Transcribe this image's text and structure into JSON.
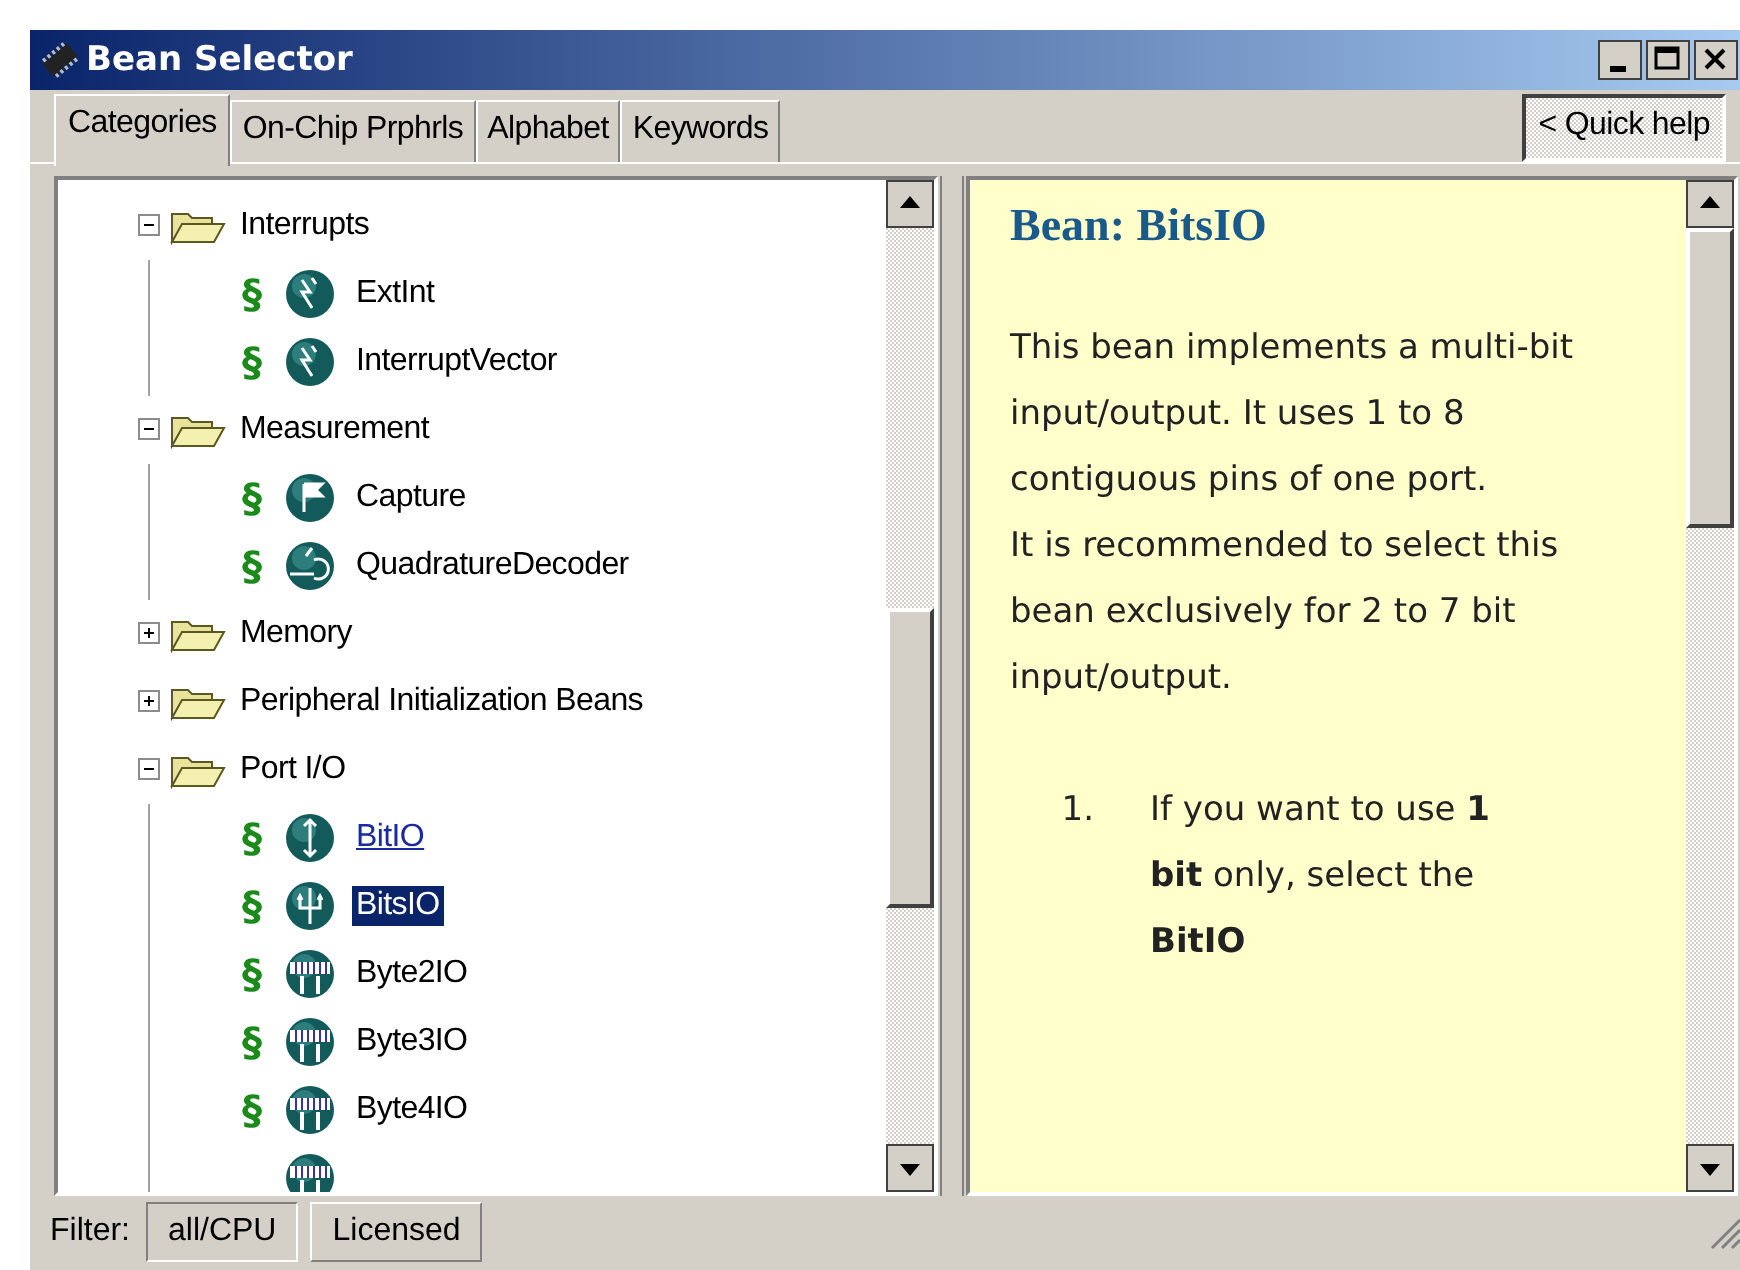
{
  "window": {
    "title": "Bean Selector"
  },
  "tabs": [
    {
      "label": "Categories",
      "selected": true
    },
    {
      "label": "On-Chip Prphrls",
      "selected": false
    },
    {
      "label": "Alphabet",
      "selected": false
    },
    {
      "label": "Keywords",
      "selected": false
    }
  ],
  "quick_help": {
    "label": "< Quick help",
    "pressed": true
  },
  "tree": [
    {
      "label": "Interrupts",
      "expanded": true,
      "children": [
        {
          "marker": "§",
          "label": "ExtInt",
          "kind": "interrupt",
          "link": false,
          "selected": false
        },
        {
          "marker": "§",
          "label": "InterruptVector",
          "kind": "interrupt",
          "link": false,
          "selected": false
        }
      ]
    },
    {
      "label": "Measurement",
      "expanded": true,
      "children": [
        {
          "marker": "§",
          "label": "Capture",
          "kind": "capture",
          "link": false,
          "selected": false
        },
        {
          "marker": "§",
          "label": "QuadratureDecoder",
          "kind": "decoder",
          "link": false,
          "selected": false
        }
      ]
    },
    {
      "label": "Memory",
      "expanded": false
    },
    {
      "label": "Peripheral Initialization Beans",
      "expanded": false
    },
    {
      "label": "Port I/O",
      "expanded": true,
      "children": [
        {
          "marker": "§",
          "label": "BitIO",
          "kind": "bit",
          "link": true,
          "selected": false
        },
        {
          "marker": "§",
          "label": "BitsIO",
          "kind": "bits",
          "link": false,
          "selected": true
        },
        {
          "marker": "§",
          "label": "Byte2IO",
          "kind": "byte",
          "link": false,
          "selected": false
        },
        {
          "marker": "§",
          "label": "Byte3IO",
          "kind": "byte",
          "link": false,
          "selected": false
        },
        {
          "marker": "§",
          "label": "Byte4IO",
          "kind": "byte",
          "link": false,
          "selected": false
        },
        {
          "kind": "byte"
        }
      ]
    }
  ],
  "help": {
    "title": "Bean: BitsIO",
    "paragraphs": [
      "This bean implements a multi-bit input/output. It uses 1 to 8 contiguous pins of one port.",
      "It is recommended to select this bean exclusively for 2 to 7 bit input/output."
    ],
    "list": [
      {
        "number": "1.",
        "text": "If you want to use **1 bit** only, select the **BitIO**"
      }
    ]
  },
  "status_bar": {
    "label": "Filter:",
    "buttons": [
      {
        "label": "all/CPU",
        "selected": true
      },
      {
        "label": "Licensed",
        "selected": false
      }
    ]
  }
}
